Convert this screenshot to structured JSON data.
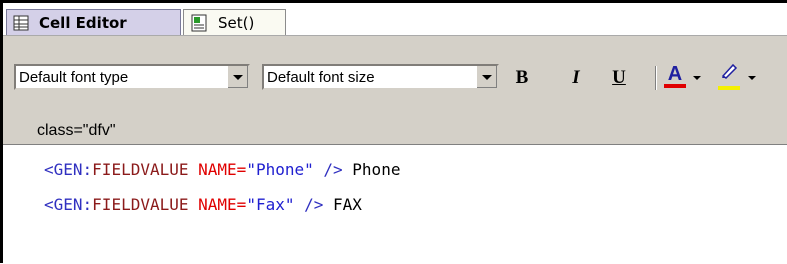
{
  "tabs": [
    {
      "label": "Cell Editor",
      "active": true,
      "icon": "grid-icon"
    },
    {
      "label": "Set()",
      "active": false,
      "icon": "script-icon"
    }
  ],
  "toolbar": {
    "font_type": "Default font type",
    "font_size": "Default font size",
    "bold": "B",
    "italic": "I",
    "underline": "U",
    "font_color_letter": "A",
    "font_color": "#e00000",
    "highlight_color": "#f5f000"
  },
  "class_attr": "class=\"dfv\"",
  "code": [
    {
      "open": "<GEN:",
      "tag": "FIELDVALUE",
      "attr": "NAME=",
      "value": "\"Phone\"",
      "close": " />",
      "text": " Phone"
    },
    {
      "open": "<GEN:",
      "tag": "FIELDVALUE",
      "attr": "NAME=",
      "value": "\"Fax\"",
      "close": " />",
      "text": " FAX"
    }
  ]
}
